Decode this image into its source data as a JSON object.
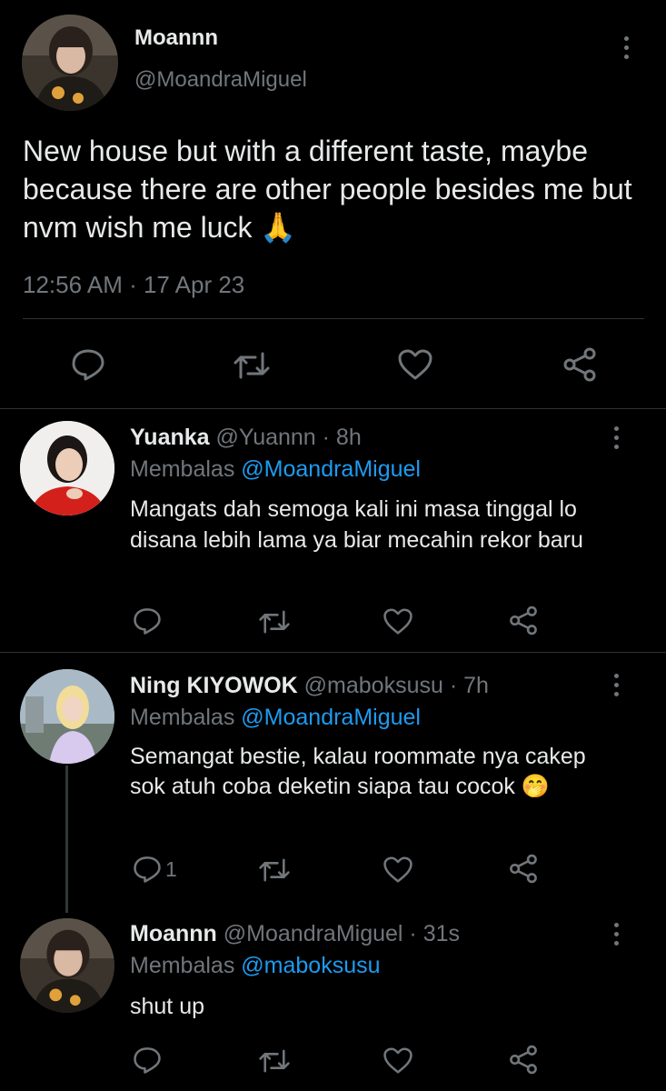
{
  "main_tweet": {
    "name": "Moannn",
    "handle": "@MoandraMiguel",
    "text": "New house but with a different taste, maybe because there are other people besides me but nvm wish me luck",
    "emoji": "🙏",
    "timestamp": "12:56 AM · 17 Apr 23"
  },
  "replies": [
    {
      "name": "Yuanka",
      "handle_time": "@Yuannn · 8h",
      "reply_prefix": "Membalas",
      "reply_to": "@MoandraMiguel",
      "text": "Mangats dah semoga kali ini masa tinggal lo disana lebih lama ya biar mecahin rekor baru",
      "reply_count": ""
    },
    {
      "name": "Ning KIYOWOK",
      "handle_time": "@maboksusu · 7h",
      "reply_prefix": "Membalas",
      "reply_to": "@MoandraMiguel",
      "text": "Semangat bestie, kalau roommate nya cakep sok atuh coba deketin siapa tau cocok",
      "emoji": "🤭",
      "reply_count": "1"
    },
    {
      "name": "Moannn",
      "handle_time": "@MoandraMiguel · 31s",
      "reply_prefix": "Membalas",
      "reply_to": "@maboksusu",
      "text": "shut up",
      "reply_count": ""
    }
  ],
  "colors": {
    "accent": "#1d9bf0",
    "muted": "#71767b",
    "text": "#e7e9ea",
    "background": "#000000"
  },
  "icons": [
    "reply-icon",
    "retweet-icon",
    "like-icon",
    "share-icon",
    "more-options-icon"
  ]
}
